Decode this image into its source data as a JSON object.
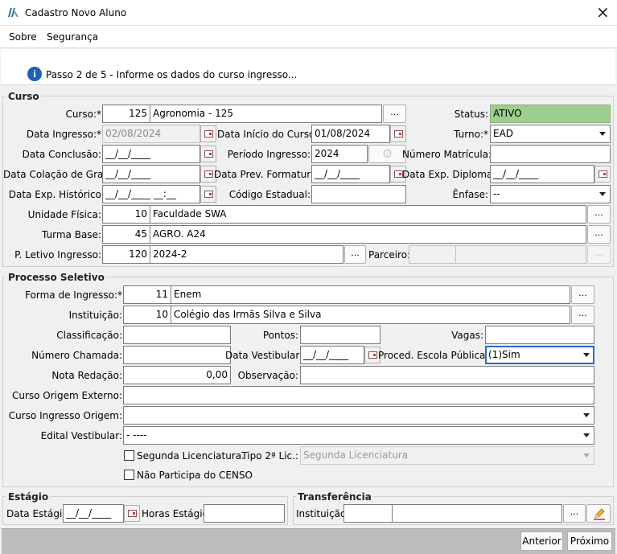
{
  "window": {
    "title": "Cadastro Novo Aluno",
    "close": "×"
  },
  "menu": {
    "about": "Sobre",
    "security": "Segurança"
  },
  "step": {
    "text": "Passo 2 de 5 - Informe os dados do curso ingresso..."
  },
  "curso": {
    "group": "Curso",
    "curso_label": "Curso:*",
    "curso_code": "125",
    "curso_name": "Agronomia - 125",
    "status_label": "Status:",
    "status_value": "ATIVO",
    "data_ingresso_label": "Data Ingresso:*",
    "data_ingresso": "02/08/2024",
    "data_inicio_label": "Data Início do Curso:",
    "data_inicio": "01/08/2024",
    "turno_label": "Turno:*",
    "turno": "EAD",
    "data_conclusao_label": "Data Conclusão:",
    "data_conclusao": "__/__/____",
    "periodo_label": "Período Ingresso:",
    "periodo": "2024",
    "matricula_label": "Número Matrícula:",
    "matricula": "",
    "colacao_label": "Data Colação de Grau:",
    "colacao": "__/__/____",
    "prev_formatura_label": "Data Prev. Formatura:",
    "prev_formatura": "__/__/____",
    "exp_diploma_label": "Data Exp. Diploma:",
    "exp_diploma": "__/__/____",
    "exp_historico_label": "Data Exp. Histórico",
    "exp_historico": "__/__/____ __:__",
    "codigo_estadual_label": "Código Estadual:",
    "codigo_estadual": "",
    "enfase_label": "Ênfase:",
    "enfase": "--",
    "unidade_label": "Unidade Física:",
    "unidade_code": "10",
    "unidade_name": "Faculdade SWA",
    "turma_label": "Turma Base:",
    "turma_code": "45",
    "turma_name": "AGRO. A24",
    "letivo_label": "P. Letivo Ingresso:",
    "letivo_code": "120",
    "letivo_name": "2024-2",
    "parceiro_label": "Parceiro:",
    "parceiro_code": "",
    "parceiro_name": "",
    "ellipsis": "...",
    "colors": {
      "status_bg": "#9fcf8f"
    }
  },
  "processo": {
    "group": "Processo Seletivo",
    "forma_label": "Forma de Ingresso:*",
    "forma_code": "11",
    "forma_name": "Enem",
    "instituicao_label": "Instituição:",
    "instituicao_code": "10",
    "instituicao_name": "Colégio das Irmãs Silva e Silva",
    "classificacao_label": "Classificação:",
    "classificacao": "",
    "pontos_label": "Pontos:",
    "pontos": "",
    "vagas_label": "Vagas:",
    "vagas": "",
    "chamada_label": "Número Chamada:",
    "chamada": "",
    "data_vest_label": "Data Vestibular:",
    "data_vest": "__/__/____",
    "proced_label": "Proced. Escola Pública:*",
    "proced": "(1)Sim",
    "nota_label": "Nota Redação:",
    "nota": "0,00",
    "observacao_label": "Observação:",
    "observacao": "",
    "origem_externo_label": "Curso Origem Externo:",
    "origem_externo": "",
    "ingresso_origem_label": "Curso Ingresso Origem:",
    "ingresso_origem": "",
    "edital_label": "Edital Vestibular:",
    "edital": "- ----",
    "segunda_lic_label": "Segunda Licenciatura.",
    "tipo_lic_label": "Tipo 2ª Lic.:",
    "tipo_lic": "Segunda Licenciatura",
    "censo_label": "Não Participa do CENSO"
  },
  "estagio": {
    "group": "Estágio",
    "data_label": "Data Estágio:",
    "data": "__/__/____",
    "horas_label": "Horas Estágio:",
    "horas": ""
  },
  "transferencia": {
    "group": "Transferência",
    "inst_label": "Instituição:",
    "inst_code": "",
    "inst_name": ""
  },
  "footer": {
    "back": "Anterior",
    "next": "Próximo"
  }
}
